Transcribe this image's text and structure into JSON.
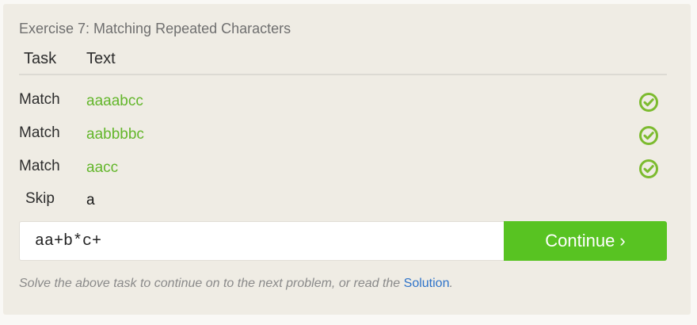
{
  "exercise": {
    "title": "Exercise 7: Matching Repeated Characters"
  },
  "table": {
    "headers": {
      "task": "Task",
      "text": "Text"
    },
    "rows": [
      {
        "task": "Match",
        "text": "aaaabcc",
        "status": "check-circle-icon"
      },
      {
        "task": "Match",
        "text": "aabbbbc",
        "status": "check-circle-icon"
      },
      {
        "task": "Match",
        "text": "aacc",
        "status": "check-circle-icon"
      },
      {
        "task": "Skip",
        "text": "a",
        "status": ""
      }
    ]
  },
  "form": {
    "regex_value": "aa+b*c+",
    "continue_label": "Continue ›"
  },
  "footer": {
    "text_before": "Solve the above task to continue on to the next problem, or read the ",
    "link_label": "Solution",
    "text_after": "."
  },
  "colors": {
    "match_text": "#63b62b",
    "check": "#7cbb2f",
    "continue_bg": "#58c322",
    "link": "#2e73c9",
    "panel_bg": "#efece4"
  }
}
